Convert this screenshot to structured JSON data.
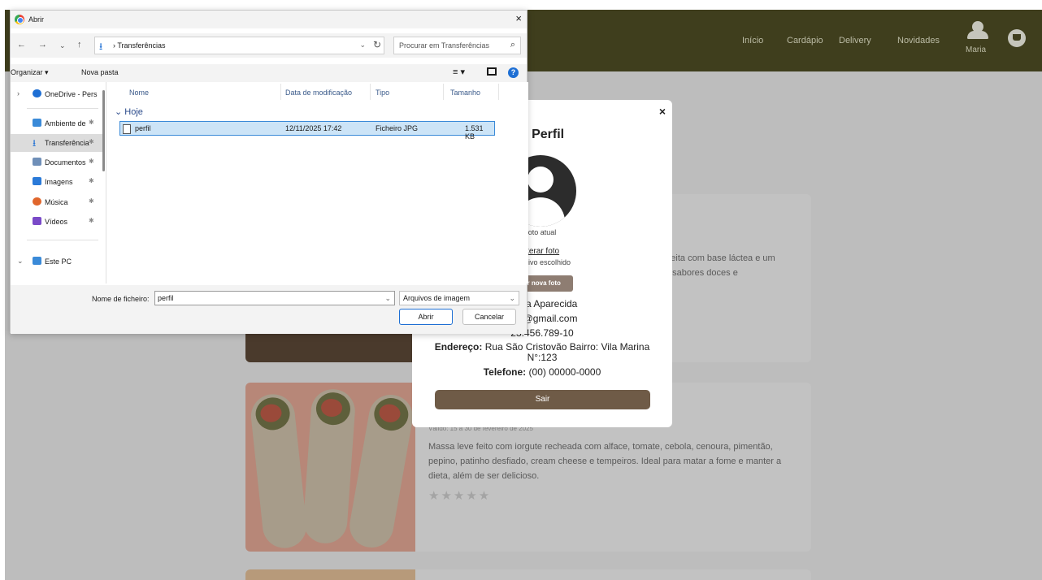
{
  "site": {
    "nav": {
      "links": [
        "Início",
        "Cardápio",
        "Delivery",
        "Novidades"
      ],
      "user_name": "Maria"
    },
    "cards": [
      {
        "description_visible": [
          "a, feita com base láctea e um",
          "cia sabores doces e"
        ]
      },
      {
        "validity": "Válido: 15 a 30 de fevereiro de 2025",
        "description_lines": [
          "Massa leve feito com iorgute recheada com alface, tomate, cebola, cenoura, pimentão,",
          "pepino, patinho desfiado, cream cheese e tempeiros. Ideal para matar a fome e manter a",
          "dieta, além de ser delicioso."
        ],
        "rating": 0,
        "stars": "★★★★★"
      }
    ]
  },
  "profile_modal": {
    "close": "×",
    "title": "u Perfil",
    "photo_caption": "oto atual",
    "change_photo_link": "lterar foto",
    "file_status": "arquivo escolhido",
    "save_photo_button": "ar nova foto",
    "name": "Maria Aparecida",
    "email": "aria@gmail.com",
    "cpf": "23.456.789-10",
    "address_label": "Endereço:",
    "address_value": "Rua São Cristovão Bairro: Vila Marina",
    "address_number": "N°:123",
    "phone_label": "Telefone:",
    "phone_value": "(00) 00000-0000",
    "logout_button": "Sair"
  },
  "file_dialog": {
    "title": "Abrir",
    "close": "×",
    "path": "Transferências",
    "search_placeholder": "Procurar em Transferências",
    "toolbar": {
      "organize": "Organizar ▾",
      "new_folder": "Nova pasta"
    },
    "nav_items": [
      {
        "label": "OneDrive - Pers",
        "icon": "cloud-icon",
        "color": "#1e6fd4"
      },
      {
        "label": "Ambiente de",
        "icon": "desktop-icon",
        "color": "#3a8ad8"
      },
      {
        "label": "Transferência",
        "icon": "download-icon",
        "color": "#1e6fd4"
      },
      {
        "label": "Documentos",
        "icon": "documents-icon",
        "color": "#6f8fb8"
      },
      {
        "label": "Imagens",
        "icon": "images-icon",
        "color": "#2a7ad8"
      },
      {
        "label": "Música",
        "icon": "music-icon",
        "color": "#e0662c"
      },
      {
        "label": "Vídeos",
        "icon": "videos-icon",
        "color": "#7a4ac8"
      },
      {
        "label": "Este PC",
        "icon": "pc-icon",
        "color": "#3a8ad8"
      }
    ],
    "columns": [
      "Nome",
      "Data de modificação",
      "Tipo",
      "Tamanho"
    ],
    "group": "Hoje",
    "files": [
      {
        "name": "perfil",
        "modified": "12/11/2025 17:42",
        "type": "Ficheiro JPG",
        "size": "1.531 KB"
      }
    ],
    "filename_label": "Nome de ficheiro:",
    "filename_value": "perfil",
    "filetype": "Arquivos de imagem",
    "open_button": "Abrir",
    "cancel_button": "Cancelar"
  }
}
